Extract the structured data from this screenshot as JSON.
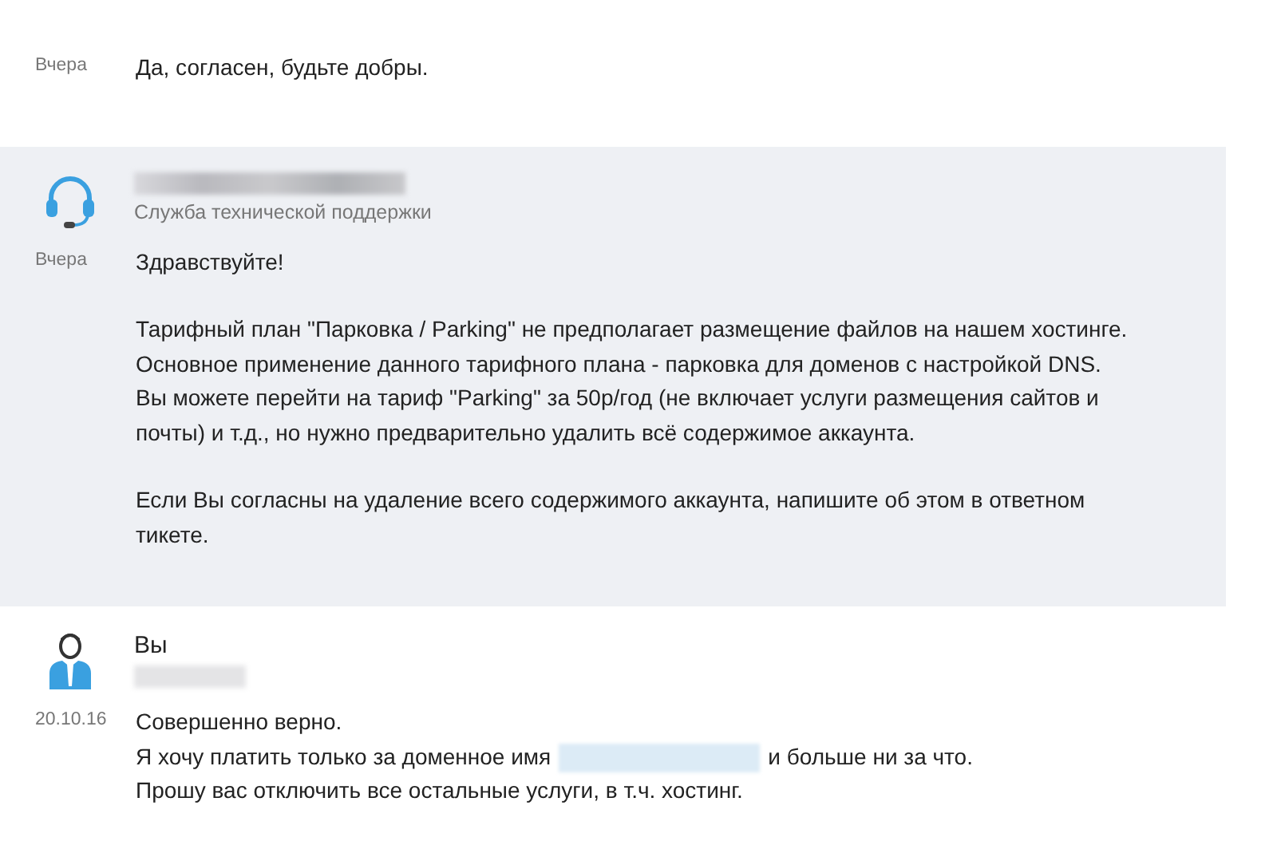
{
  "messages": [
    {
      "kind": "reply",
      "highlighted": false,
      "date": "Вчера",
      "paragraphs": [
        [
          [
            {
              "kind": "text",
              "text": "Да, согласен, будьте добры."
            }
          ]
        ]
      ]
    },
    {
      "kind": "support",
      "highlighted": true,
      "role": "Служба технической поддержки",
      "date": "Вчера",
      "paragraphs": [
        [
          [
            {
              "kind": "text",
              "text": "Здравствуйте!"
            }
          ]
        ],
        [
          [
            {
              "kind": "text",
              "text": "Тарифный план \"Парковка / Parking\" не предполагает размещение файлов на нашем хостинге."
            }
          ],
          [
            {
              "kind": "text",
              "text": "Основное применение данного тарифного плана - парковка для доменов с настройкой DNS."
            }
          ],
          [
            {
              "kind": "text",
              "text": "Вы можете перейти на тариф \"Parking\" за 50р/год (не включает услуги размещения сайтов и"
            }
          ],
          [
            {
              "kind": "text",
              "text": "почты) и т.д., но нужно предварительно удалить всё содержимое аккаунта."
            }
          ]
        ],
        [
          [
            {
              "kind": "text",
              "text": "Если Вы согласны на удаление всего содержимого аккаунта, напишите об этом в ответном"
            }
          ],
          [
            {
              "kind": "text",
              "text": "тикете."
            }
          ]
        ]
      ]
    },
    {
      "kind": "user",
      "highlighted": false,
      "author": "Вы",
      "date": "20.10.16",
      "paragraphs": [
        [
          [
            {
              "kind": "text",
              "text": "Совершенно верно."
            }
          ],
          [
            {
              "kind": "text",
              "text": "Я хочу платить только за доменное имя"
            },
            {
              "kind": "redacted"
            },
            {
              "kind": "text",
              "text": "и больше ни за что."
            }
          ],
          [
            {
              "kind": "text",
              "text": "Прошу вас отключить все остальные услуги, в т.ч. хостинг."
            }
          ]
        ]
      ]
    }
  ]
}
